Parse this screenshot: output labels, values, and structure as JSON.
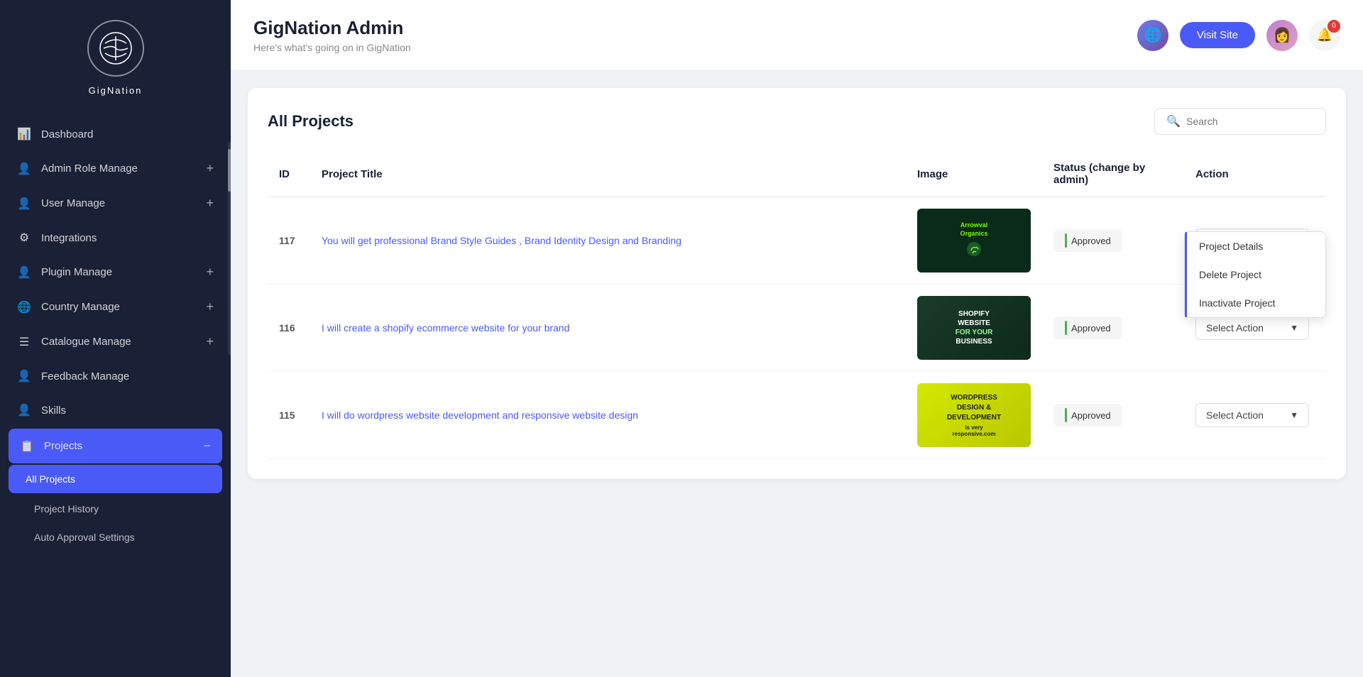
{
  "app": {
    "title": "GigNation Admin",
    "subtitle": "Here's what's going on in GigNation",
    "logo_text": "GigNation",
    "visit_site_label": "Visit Site"
  },
  "topbar": {
    "notification_count": "0"
  },
  "sidebar": {
    "nav_items": [
      {
        "id": "dashboard",
        "label": "Dashboard",
        "icon": "📊",
        "has_plus": false
      },
      {
        "id": "admin-role-manage",
        "label": "Admin Role Manage",
        "icon": "👤",
        "has_plus": true
      },
      {
        "id": "user-manage",
        "label": "User Manage",
        "icon": "👤",
        "has_plus": true
      },
      {
        "id": "integrations",
        "label": "Integrations",
        "icon": "⚙",
        "has_plus": false
      },
      {
        "id": "plugin-manage",
        "label": "Plugin Manage",
        "icon": "👤",
        "has_plus": true
      },
      {
        "id": "country-manage",
        "label": "Country Manage",
        "icon": "🌐",
        "has_plus": true
      },
      {
        "id": "catalogue-manage",
        "label": "Catalogue Manage",
        "icon": "☰",
        "has_plus": true
      },
      {
        "id": "feedback-manage",
        "label": "Feedback Manage",
        "icon": "👤",
        "has_plus": false
      },
      {
        "id": "skills",
        "label": "Skills",
        "icon": "👤",
        "has_plus": false
      },
      {
        "id": "projects",
        "label": "Projects",
        "icon": "📋",
        "has_plus": false,
        "is_active": true
      }
    ],
    "projects_sub_items": [
      {
        "id": "all-projects",
        "label": "All Projects",
        "is_active": true
      },
      {
        "id": "project-history",
        "label": "Project History",
        "is_active": false
      },
      {
        "id": "auto-approval-settings",
        "label": "Auto Approval Settings",
        "is_active": false
      }
    ]
  },
  "page": {
    "title": "All Projects",
    "search_placeholder": "Search"
  },
  "table": {
    "columns": [
      "ID",
      "Project Title",
      "Image",
      "Status (change by admin)",
      "Action"
    ],
    "rows": [
      {
        "id": "117",
        "title": "You will get professional Brand Style Guides , Brand Identity Design and Branding",
        "image_type": "brand",
        "image_label": "Arrowval Organics",
        "status": "Approved",
        "action_label": "Select Action",
        "dropdown_open": true,
        "dropdown_items": [
          "Project Details",
          "Delete Project",
          "Inactivate Project"
        ]
      },
      {
        "id": "116",
        "title": "I will create a shopify ecommerce website for your brand",
        "image_type": "shopify",
        "image_label": "SHOPIFY WEBSITE FOR YOUR BUSINESS",
        "status": "Approved",
        "action_label": "Select Action",
        "dropdown_open": false,
        "dropdown_items": []
      },
      {
        "id": "115",
        "title": "I will do wordpress website development and responsive website design",
        "image_type": "wordpress",
        "image_label": "WORDPRESS DESIGN & DEVELOPMENT",
        "status": "Approved",
        "action_label": "Select Action",
        "dropdown_open": false,
        "dropdown_items": []
      }
    ]
  }
}
